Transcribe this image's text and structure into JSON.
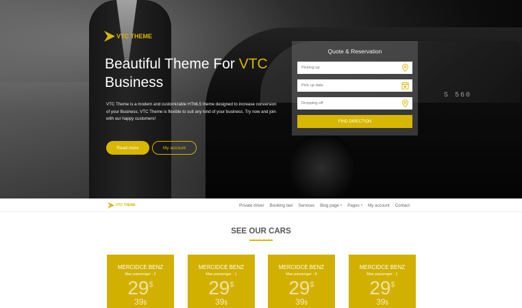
{
  "brand": {
    "name": "VTC THEME",
    "accent": "#d8b700"
  },
  "hero": {
    "title_line1": "Beautiful Theme For ",
    "title_accent": "VTC",
    "title_line2": "Business",
    "description": "VTC Theme is a modern and customizable HTML5 theme designed to increase conversion of your Business. VTC Theme is flexible to suit any kind of your business. Try now and join with our happy customers!",
    "read_more": "Read more",
    "my_account": "My account",
    "plate_text": "S 560"
  },
  "quote": {
    "title": "Quote & Reservation",
    "picking_up_placeholder": "Picking up",
    "pickup_date_placeholder": "Pick up date",
    "dropping_off_placeholder": "Dropping off",
    "find_button": "FIND DIRECTION"
  },
  "nav": {
    "items": [
      {
        "label": "Private driver",
        "has_caret": false
      },
      {
        "label": "Booking taxi",
        "has_caret": false
      },
      {
        "label": "Services",
        "has_caret": false
      },
      {
        "label": "Blog page",
        "has_caret": true
      },
      {
        "label": "Pages",
        "has_caret": true
      },
      {
        "label": "My account",
        "has_caret": false
      },
      {
        "label": "Contact",
        "has_caret": false
      }
    ],
    "caret_glyph": "▾"
  },
  "cars": {
    "title": "SEE OUR CARS",
    "items": [
      {
        "name": "MERCIDCE BENZ",
        "passenger": "Max passenger : 2",
        "price": "29",
        "old_price": "39",
        "currency": "$"
      },
      {
        "name": "MERCIDCE BENZ",
        "passenger": "Max passenger : 1",
        "price": "29",
        "old_price": "39",
        "currency": "$"
      },
      {
        "name": "MERCIDCE BENZ",
        "passenger": "Max passenger : 8",
        "price": "29",
        "old_price": "39",
        "currency": "$"
      },
      {
        "name": "MERCIDCE BENZ",
        "passenger": "Max passenger : 1",
        "price": "29",
        "old_price": "39",
        "currency": "$"
      }
    ]
  }
}
